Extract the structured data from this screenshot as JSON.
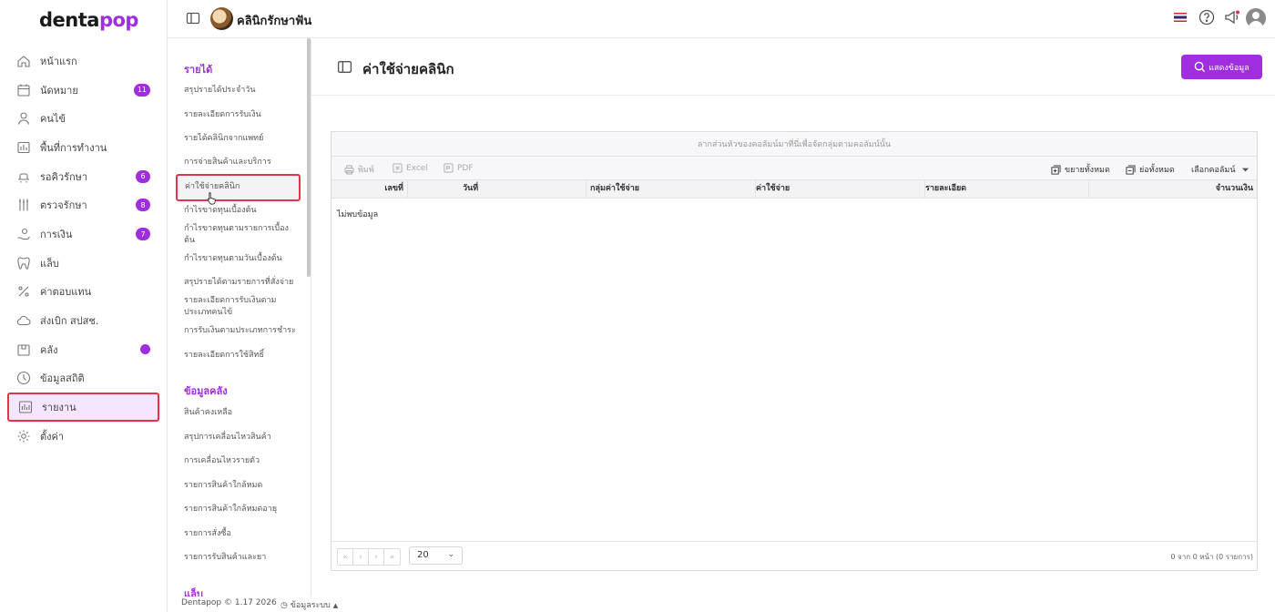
{
  "app": {
    "logo_part1": "denta",
    "logo_part2": "pop",
    "clinic_name": "คลินิกรักษาฟัน"
  },
  "sidebar": {
    "items": [
      {
        "label": "หน้าแรก",
        "icon": "home-icon"
      },
      {
        "label": "นัดหมาย",
        "icon": "calendar-icon",
        "badge": "11"
      },
      {
        "label": "คนไข้",
        "icon": "user-icon"
      },
      {
        "label": "พื้นที่การทำงาน",
        "icon": "workspace-icon"
      },
      {
        "label": "รอคิวรักษา",
        "icon": "dental-chair-icon",
        "badge": "6"
      },
      {
        "label": "ตรวจรักษา",
        "icon": "dental-tools-icon",
        "badge": "8"
      },
      {
        "label": "การเงิน",
        "icon": "money-hand-icon",
        "badge": "7"
      },
      {
        "label": "แล็บ",
        "icon": "tooth-icon"
      },
      {
        "label": "ค่าตอบแทน",
        "icon": "percent-icon"
      },
      {
        "label": "ส่งเบิก สปสช.",
        "icon": "cloud-icon"
      },
      {
        "label": "คลัง",
        "icon": "inventory-box-icon",
        "dot": true
      },
      {
        "label": "ข้อมูลสถิติ",
        "icon": "statistics-icon"
      },
      {
        "label": "รายงาน",
        "icon": "report-chart-icon",
        "active": true
      },
      {
        "label": "ตั้งค่า",
        "icon": "gear-icon"
      }
    ]
  },
  "report_menu": {
    "income_title": "รายได้",
    "income_links": [
      "สรุปรายได้ประจำวัน",
      "รายละเอียดการรับเงิน",
      "รายได้คลินิกจากแพทย์",
      "การจ่ายสินค้าและบริการ",
      "ค่าใช้จ่ายคลินิก",
      "กำไรขาดทุนเบื้องต้น",
      "กำไรขาดทุนตามรายการเบื้องต้น",
      "กำไรขาดทุนตามวันเบื้องต้น",
      "สรุปรายได้ตามรายการที่สั่งจ่าย",
      "รายละเอียดการรับเงินตามประเภทคนไข้",
      "การรับเงินตามประเภทการชำระ",
      "รายละเอียดการใช้สิทธิ์"
    ],
    "stock_title": "ข้อมูลคลัง",
    "stock_links": [
      "สินค้าคงเหลือ",
      "สรุปการเคลื่อนไหวสินค้า",
      "การเคลื่อนไหวรายตัว",
      "รายการสินค้าใกล้หมด",
      "รายการสินค้าใกล้หมดอายุ",
      "รายการสั่งซื้อ",
      "รายการรับสินค้าและยา"
    ],
    "lab_title": "แล็บ"
  },
  "page": {
    "title": "ค่าใช้จ่ายคลินิก",
    "show_button": "แสดงข้อมูล"
  },
  "grid": {
    "group_hint": "ลากส่วนหัวของคอลัมน์มาที่นี่เพื่อจัดกลุ่มตามคอลัมน์นั้น",
    "print": "พิมพ์",
    "excel": "Excel",
    "pdf": "PDF",
    "expand_all": "ขยายทั้งหมด",
    "collapse_all": "ย่อทั้งหมด",
    "choose_columns": "เลือกคอลัมน์",
    "columns": [
      "เลขที่",
      "วันที่",
      "กลุ่มค่าใช้จ่าย",
      "ค่าใช้จ่าย",
      "รายละเอียด",
      "จำนวนเงิน"
    ],
    "no_data": "ไม่พบข้อมูล",
    "page_size": "20",
    "pager_info": "0 จาก 0 หน้า (0 รายการ)"
  },
  "footer": {
    "version": "Dentapop © 1.17 2026",
    "system_info": "ข้อมูลระบบ"
  }
}
